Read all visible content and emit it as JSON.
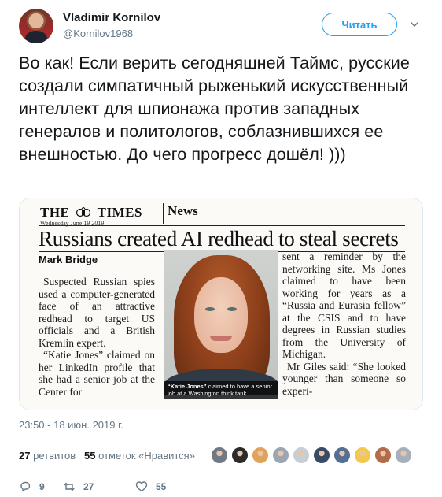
{
  "header": {
    "display_name": "Vladimir Kornilov",
    "handle": "@Kornilov1968",
    "follow_label": "Читать"
  },
  "tweet": {
    "text": "Во как! Если верить сегодняшней Таймс, русские создали симпатичный рыженький искусственный интеллект для шпионажа против западных генералов и политологов, соблазнившихся ее внешностью. До чего прогресс дошёл! )))"
  },
  "media": {
    "masthead_left": "THE",
    "masthead_right": "TIMES",
    "paper_date": "Wednesday June 19 2019",
    "section": "News",
    "headline": "Russians created AI redhead to steal secrets",
    "byline": "Mark Bridge",
    "col_left": [
      "Suspected Russian spies used a computer-generated face of an attractive redhead to target US officials and a British Kremlin expert.",
      "“Katie Jones” claimed on her LinkedIn profile that she had a senior job at the Center for"
    ],
    "col_right": [
      "sent a reminder by the networking site. Ms Jones claimed to have been working for years as a “Russia and Eurasia fellow” at the CSIS and to have degrees in Russian studies from the University of Michigan.",
      "Mr Giles said: “She looked younger than someone so experi-"
    ],
    "caption_name": "“Katie Jones”",
    "caption_rest": " claimed to have a senior job at a Washington think tank"
  },
  "meta": {
    "timestamp": "23:50 - 18 июн. 2019 г.",
    "retweets_count": "27",
    "retweets_label": "ретвитов",
    "likes_count": "55",
    "likes_label": "отметок «Нравится»",
    "liker_colors": [
      "#6f7a86",
      "#2b2b2b",
      "#e0a35b",
      "#9aa6b2",
      "#c9ced4",
      "#3a4a66",
      "#546e94",
      "#f2c94c",
      "#b36b4a",
      "#a7b0ba"
    ]
  },
  "actions": {
    "reply_count": "9",
    "retweet_count": "27",
    "like_count": "55"
  },
  "colors": {
    "accent": "#1da1f2",
    "secondary_text": "#657786",
    "divider": "#e6ecf0"
  }
}
